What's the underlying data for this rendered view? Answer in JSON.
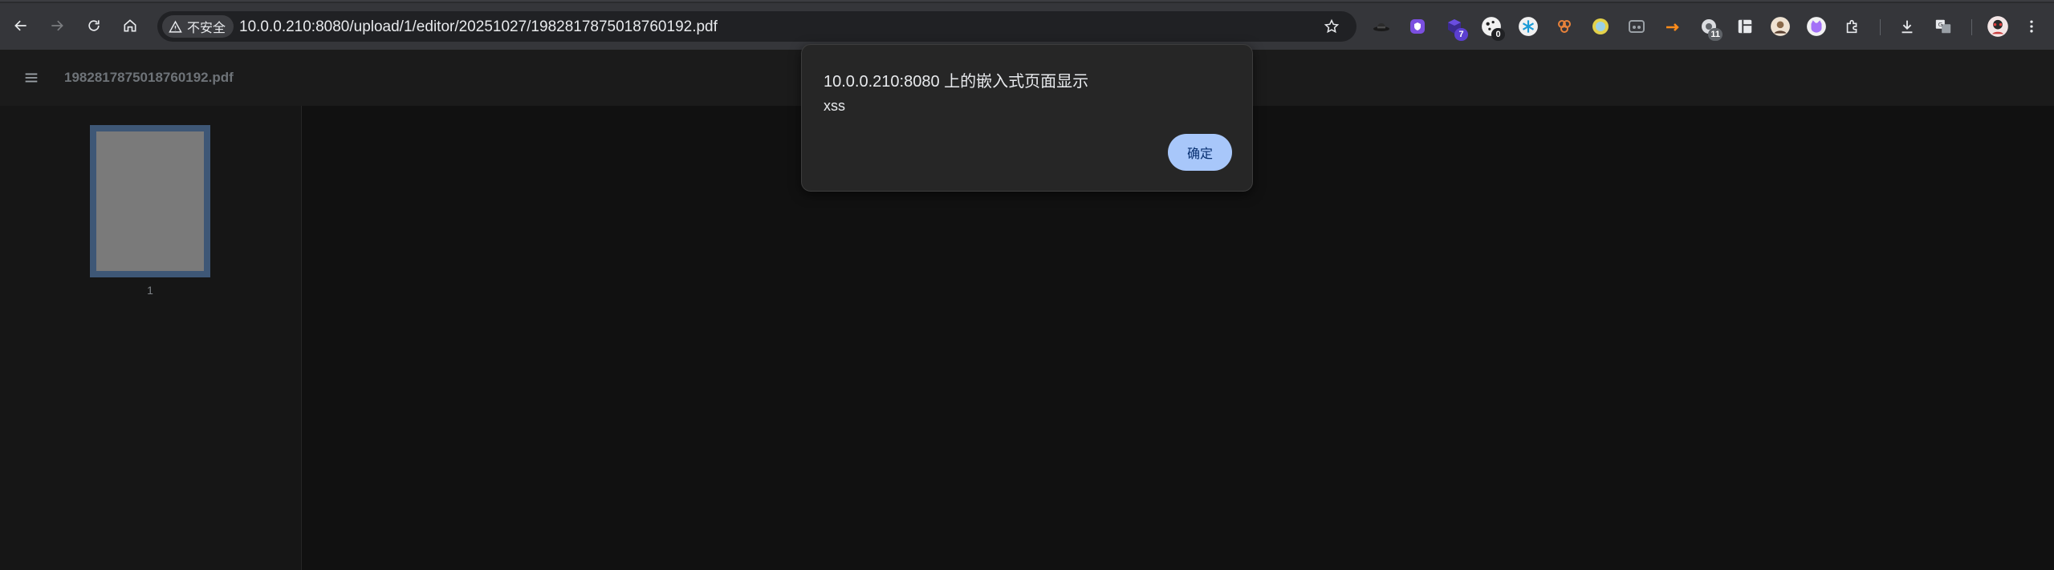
{
  "browser": {
    "nav": {
      "back": "back-arrow-icon",
      "forward": "forward-arrow-icon",
      "reload": "reload-icon",
      "home": "home-icon"
    },
    "security_chip": {
      "icon": "warning-triangle-icon",
      "label": "不安全"
    },
    "url": "10.0.0.210:8080/upload/1/editor/20251027/1982817875018760192.pdf",
    "extensions": [
      {
        "name": "hat-extension-icon"
      },
      {
        "name": "shield-extension-icon",
        "color": "#7b4fe0"
      },
      {
        "name": "cube-extension-icon",
        "badge": "7",
        "badge_color": "#5b3fd1"
      },
      {
        "name": "cookie-extension-icon",
        "badge": "0",
        "badge_color": "#202124"
      },
      {
        "name": "snowflake-extension-icon",
        "color": "#1a9bd7"
      },
      {
        "name": "honeycomb-extension-icon",
        "color": "#e8823a"
      },
      {
        "name": "circle-extension-icon",
        "color": "#e3d14a"
      },
      {
        "name": "mask-extension-icon"
      },
      {
        "name": "arrow-extension-icon",
        "color": "#ff8c1a"
      },
      {
        "name": "cloud-extension-icon",
        "badge": "11",
        "badge_color": "#5f6368"
      },
      {
        "name": "grid-extension-icon"
      },
      {
        "name": "avatar-extension-icon"
      },
      {
        "name": "cat-extension-icon",
        "color": "#a371f7"
      },
      {
        "name": "puzzle-icon"
      },
      {
        "name": "download-icon"
      },
      {
        "name": "translate-icon"
      },
      {
        "name": "profile-avatar-icon"
      },
      {
        "name": "kebab-menu-icon"
      }
    ]
  },
  "viewer": {
    "menu_icon": "hamburger-menu-icon",
    "title": "1982817875018760192.pdf",
    "thumbnails": [
      {
        "label": "1"
      }
    ]
  },
  "dialog": {
    "title": "10.0.0.210:8080 上的嵌入式页面显示",
    "message": "xss",
    "ok_label": "确定"
  },
  "colors": {
    "toolbar_bg": "#35363a",
    "omnibox_bg": "#202124",
    "viewer_bg": "#111111",
    "dialog_bg": "#262626",
    "button_accent": "#a8c7fa",
    "thumbnail_border": "#3e5776"
  }
}
